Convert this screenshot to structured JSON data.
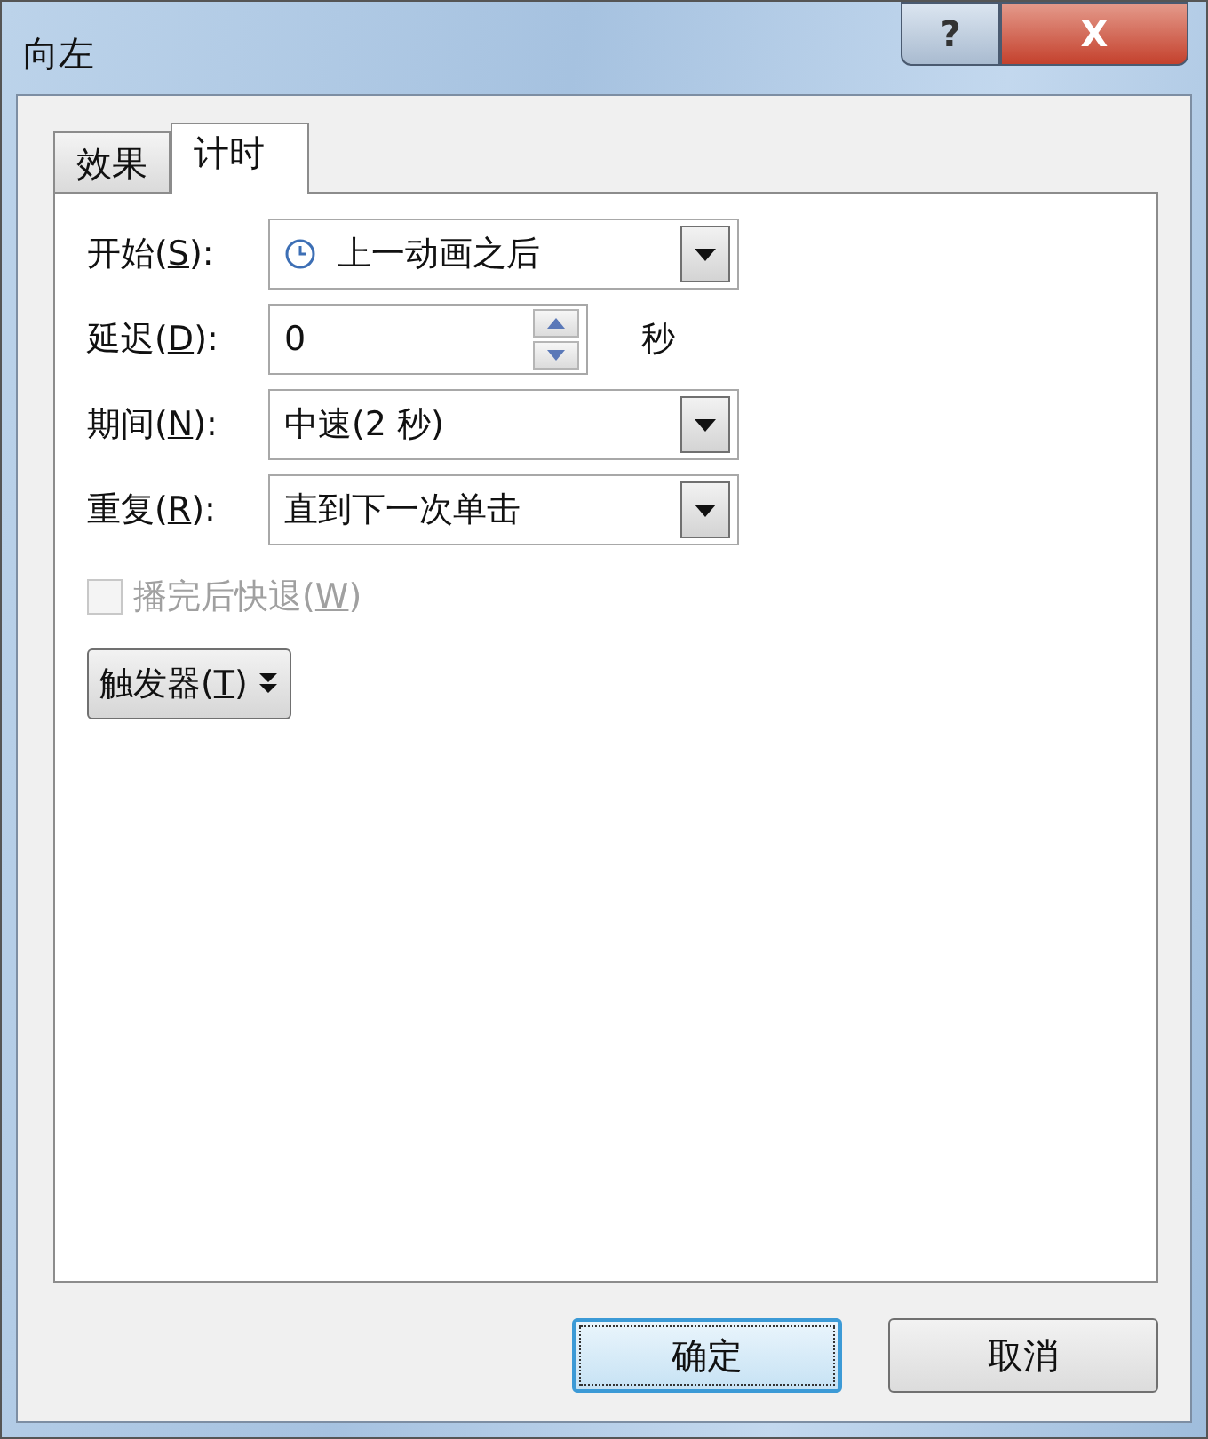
{
  "window": {
    "title": "向左",
    "help": "?",
    "close": "X"
  },
  "tabs": [
    {
      "label": "效果",
      "selected": false
    },
    {
      "label": "计时",
      "selected": true
    }
  ],
  "fields": [
    {
      "kind": "clock_dropdown",
      "label_before": "开始(",
      "accel": "S",
      "label_after": "):",
      "value": "上一动画之后"
    },
    {
      "kind": "spinner",
      "label_before": "延迟(",
      "accel": "D",
      "label_after": "):",
      "value": "0",
      "unit": "秒"
    },
    {
      "kind": "dropdown",
      "label_before": "期间(",
      "accel": "N",
      "label_after": "):",
      "value": "中速(2 秒)"
    },
    {
      "kind": "dropdown",
      "label_before": "重复(",
      "accel": "R",
      "label_after": "):",
      "value": "直到下一次单击"
    }
  ],
  "rewind_checkbox": {
    "label_before": "播完后快退(",
    "accel": "W",
    "label_after": ")",
    "checked": false,
    "disabled": true
  },
  "trigger_button": {
    "label_before": "触发器(",
    "accel": "T",
    "label_after": ")"
  },
  "buttons": [
    {
      "label": "确定",
      "default": true
    },
    {
      "label": "取消",
      "default": false
    }
  ]
}
